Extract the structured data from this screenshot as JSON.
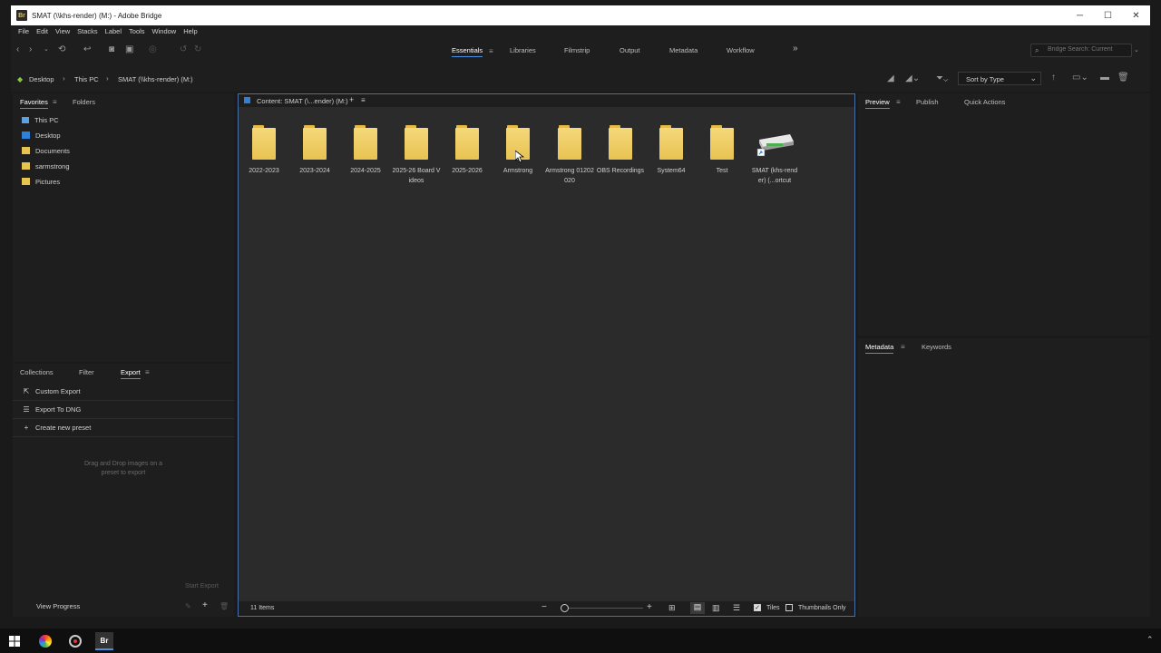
{
  "window": {
    "title": "SMAT (\\\\khs-render) (M:) - Adobe Bridge",
    "app_badge": "Br",
    "controls": [
      "─",
      "☐",
      "✕"
    ]
  },
  "menu": [
    "File",
    "Edit",
    "View",
    "Stacks",
    "Label",
    "Tools",
    "Window",
    "Help"
  ],
  "workspaces": {
    "tabs": [
      "Essentials",
      "Libraries",
      "Filmstrip",
      "Output",
      "Metadata",
      "Workflow"
    ],
    "active": "Essentials",
    "more": "»"
  },
  "search": {
    "placeholder": "Bridge Search: Current"
  },
  "breadcrumb": [
    "Desktop",
    "This PC",
    "SMAT (\\\\khs-render) (M:)"
  ],
  "sort": {
    "label": "Sort by Type"
  },
  "favorites": {
    "tabs": [
      "Favorites",
      "Folders"
    ],
    "items": [
      {
        "label": "This PC",
        "icon": "pc-icon"
      },
      {
        "label": "Desktop",
        "icon": "desktop-icon"
      },
      {
        "label": "Documents",
        "icon": "folder-icon"
      },
      {
        "label": "sarmstrong",
        "icon": "folder-icon"
      },
      {
        "label": "Pictures",
        "icon": "folder-icon"
      }
    ]
  },
  "export": {
    "tabs": [
      "Collections",
      "Filter",
      "Export"
    ],
    "active": "Export",
    "items": [
      {
        "label": "Custom Export",
        "icon": "export-icon"
      },
      {
        "label": "Export To DNG",
        "icon": "list-icon"
      },
      {
        "label": "Create new preset",
        "icon": "plus-icon"
      }
    ],
    "drop_hint_1": "Drag and Drop images on a",
    "drop_hint_2": "preset to export",
    "start_button": "Start Export",
    "view_progress": "View Progress"
  },
  "content": {
    "header": "Content: SMAT (\\...ender) (M:)",
    "items": [
      {
        "label": "2022-2023",
        "type": "folder"
      },
      {
        "label": "2023-2024",
        "type": "folder"
      },
      {
        "label": "2024-2025",
        "type": "folder"
      },
      {
        "label": "2025-26 Board Videos",
        "type": "folder"
      },
      {
        "label": "2025-2026",
        "type": "folder"
      },
      {
        "label": "Armstrong",
        "type": "folder"
      },
      {
        "label": "Armstrong 01202020",
        "type": "folder"
      },
      {
        "label": "OBS Recordings",
        "type": "folder"
      },
      {
        "label": "System64",
        "type": "folder"
      },
      {
        "label": "Test",
        "type": "folder"
      },
      {
        "label": "SMAT (khs-render) (...ortcut",
        "type": "drive-shortcut"
      }
    ],
    "count": "11 Items",
    "view_options": {
      "tiles": "Tiles",
      "thumbnails_only": "Thumbnails Only"
    }
  },
  "right_panels": {
    "preview_tabs": [
      "Preview",
      "Publish",
      "Quick Actions"
    ],
    "metadata_tabs": [
      "Metadata",
      "Keywords"
    ]
  },
  "colors": {
    "accent": "#4a90e2",
    "folder": "#f0cf6a",
    "panel_bg": "#1e1e1e",
    "content_bg": "#2b2b2b"
  }
}
